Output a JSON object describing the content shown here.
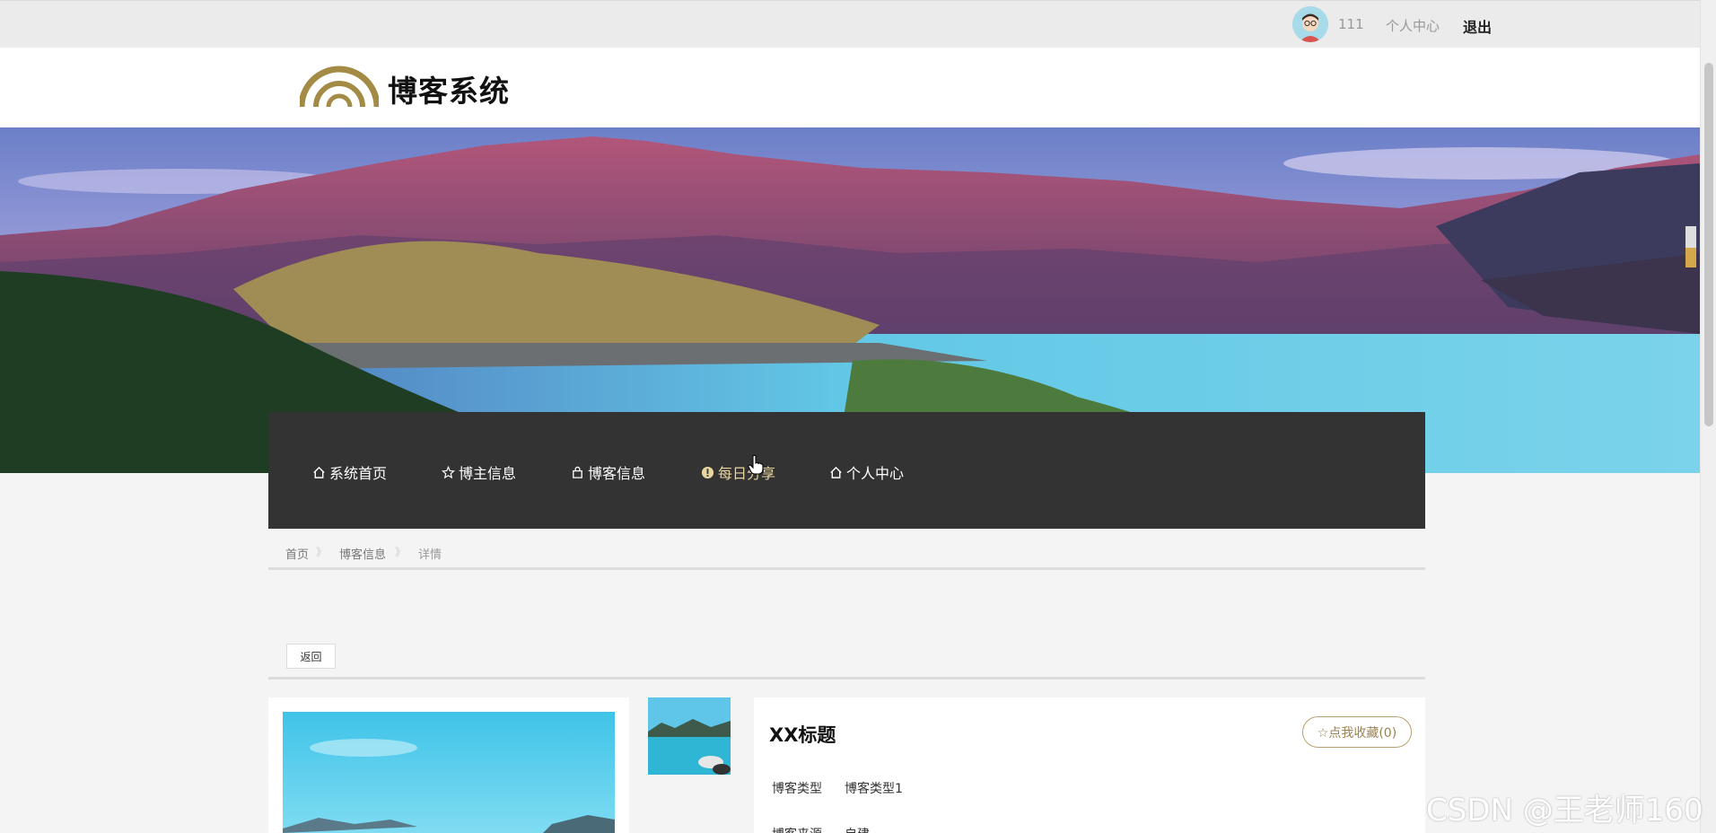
{
  "topbar": {
    "username": "111",
    "personal_center": "个人中心",
    "logout": "退出"
  },
  "header": {
    "site_title": "博客系统",
    "logo_color": "#a38a45"
  },
  "nav": {
    "items": [
      {
        "label": "系统首页",
        "icon": "home-icon"
      },
      {
        "label": "博主信息",
        "icon": "star-icon"
      },
      {
        "label": "博客信息",
        "icon": "bag-icon"
      },
      {
        "label": "每日分享",
        "icon": "info-icon"
      },
      {
        "label": "个人中心",
        "icon": "home-icon"
      }
    ],
    "active_index": 3,
    "background": "#333333"
  },
  "breadcrumb": {
    "items": [
      "首页",
      "博客信息",
      "详情"
    ],
    "separator": "》"
  },
  "back_button": "返回",
  "detail": {
    "title": "XX标题",
    "favorite_button": "☆点我收藏(0)",
    "fields": [
      {
        "label": "博客类型",
        "value": "博客类型1"
      },
      {
        "label": "博客来源",
        "value": "自建"
      }
    ]
  },
  "watermark": "CSDN @王老师160",
  "colors": {
    "accent_gold": "#b8a070",
    "nav_dark": "#333333",
    "page_bg": "#f4f4f4"
  }
}
